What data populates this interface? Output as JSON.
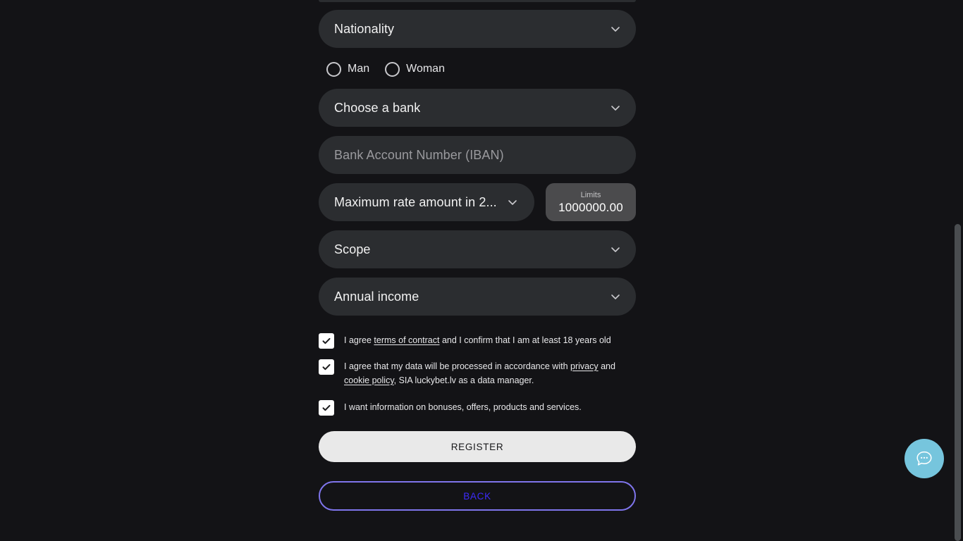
{
  "form": {
    "clipped_field_above": "",
    "nationality": {
      "label": "Nationality",
      "chevron_icon": "chevron-down-icon"
    },
    "gender": {
      "options": [
        {
          "label": "Man",
          "selected": false
        },
        {
          "label": "Woman",
          "selected": false
        }
      ]
    },
    "bank": {
      "label": "Choose a bank",
      "chevron_icon": "chevron-down-icon"
    },
    "iban": {
      "placeholder": "Bank Account Number (IBAN)",
      "value": ""
    },
    "max_rate": {
      "label": "Maximum rate amount in 2...",
      "chevron_icon": "chevron-down-icon"
    },
    "limits": {
      "caption": "Limits",
      "value": "1000000.00"
    },
    "scope": {
      "label": "Scope",
      "chevron_icon": "chevron-down-icon"
    },
    "annual_income": {
      "label": "Annual income",
      "chevron_icon": "chevron-down-icon"
    },
    "agreements": [
      {
        "checked": true,
        "icon": "check-icon",
        "parts": [
          {
            "text": "I agree ",
            "link": false
          },
          {
            "text": "terms of contract",
            "link": true
          },
          {
            "text": " and I confirm that I am at least 18 years old",
            "link": false
          }
        ]
      },
      {
        "checked": true,
        "icon": "check-icon",
        "parts": [
          {
            "text": "I agree that my data will be processed in accordance with ",
            "link": false
          },
          {
            "text": "privacy",
            "link": true
          },
          {
            "text": " and ",
            "link": false
          },
          {
            "text": "cookie policy",
            "link": true
          },
          {
            "text": ", SIA luckybet.lv as a data manager.",
            "link": false
          }
        ]
      },
      {
        "checked": true,
        "icon": "check-icon",
        "parts": [
          {
            "text": "I want information on bonuses, offers, products and services.",
            "link": false
          }
        ]
      }
    ],
    "register_button": "REGISTER",
    "back_button": "BACK"
  },
  "chat_widget": {
    "icon": "chat-bubble-icon",
    "color": "#76c5dd"
  },
  "scrollbar": {
    "thumb_color": "#4a4d50"
  },
  "colors": {
    "page_background": "#131316",
    "field_background": "#2b2d30",
    "limits_background": "#4b4b4d",
    "register_background": "#e9e9e9",
    "back_border": "#7f75ec",
    "back_text": "#3d2bfb",
    "text_primary": "#f2f2f2",
    "text_placeholder": "#9a9a9e"
  }
}
